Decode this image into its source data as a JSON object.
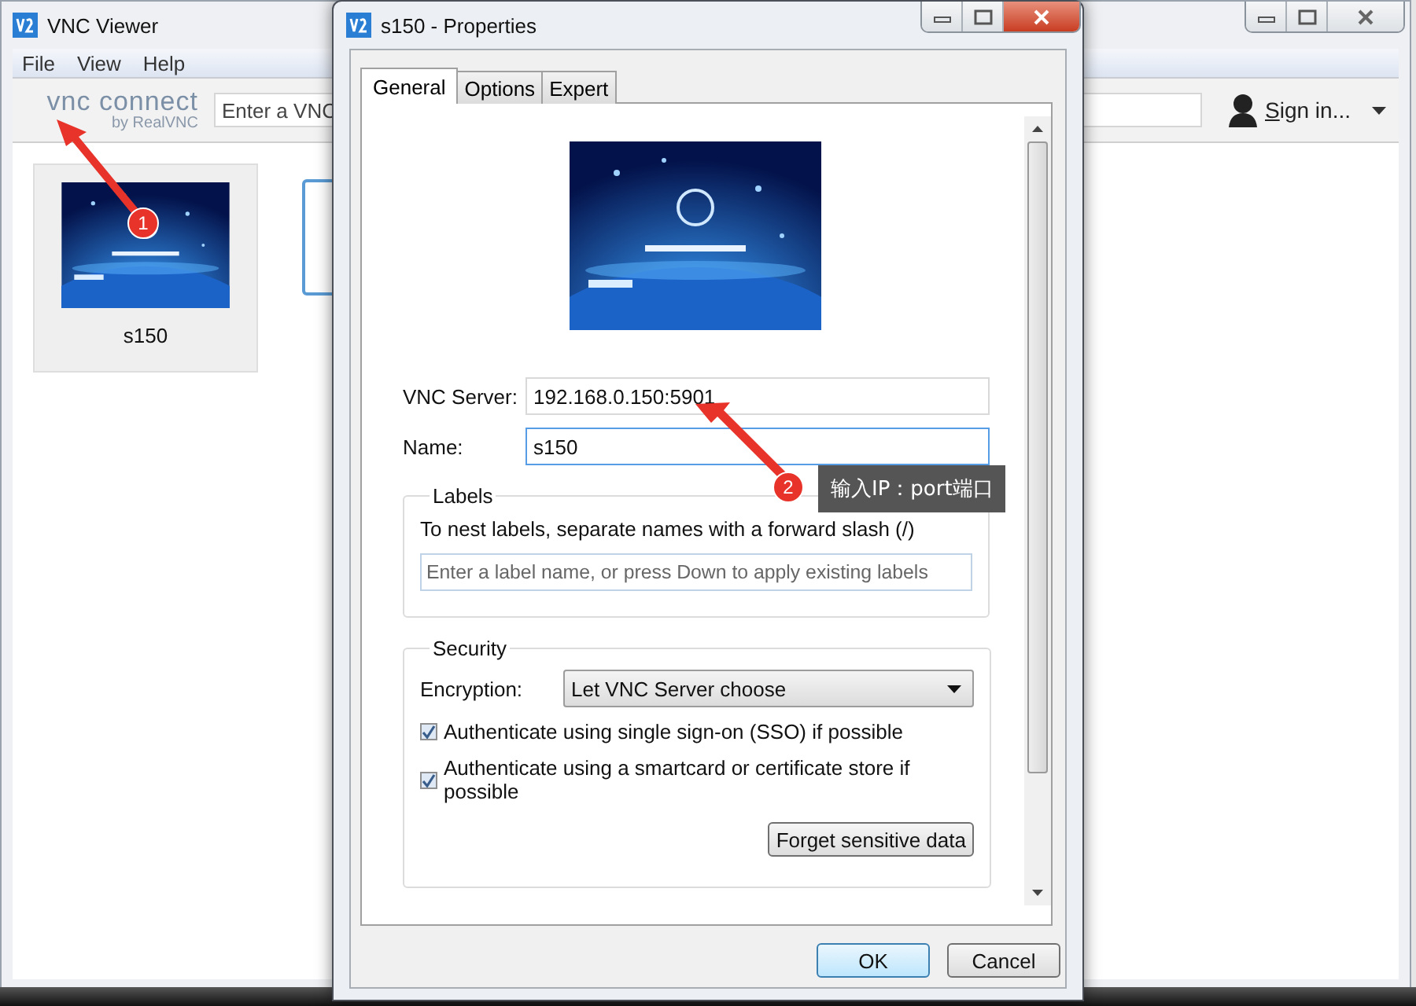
{
  "main_window": {
    "title": "VNC Viewer",
    "menu": [
      "File",
      "View",
      "Help"
    ],
    "logo": {
      "name": "vnc connect",
      "byline": "by RealVNC"
    },
    "address_field": {
      "placeholder": "Enter a VNC"
    },
    "sign_in": "Sign in...",
    "connections": [
      {
        "name": "s150",
        "selected": true,
        "kind": "picture"
      },
      {
        "selected": false
      }
    ]
  },
  "dialog": {
    "title": "s150 - Properties",
    "tabs": [
      {
        "label": "General",
        "selected": true
      },
      {
        "label": "Options",
        "selected": false
      },
      {
        "label": "Expert",
        "selected": false
      }
    ],
    "vnc_server": {
      "label": "VNC Server:",
      "value": "192.168.0.150:5901",
      "focused": false
    },
    "name": {
      "label": "Name:",
      "value": "s150",
      "focused": true
    },
    "labels": {
      "title": "Labels",
      "hint": "To nest labels, separate names with a forward slash (/)",
      "placeholder": "Enter a label name, or press Down to apply existing labels"
    },
    "security": {
      "title": "Security",
      "encryption": {
        "label": "Encryption:",
        "value": "Let VNC Server choose"
      },
      "options": [
        {
          "label": "Authenticate using single sign-on (SSO) if possible",
          "checked": true
        },
        {
          "label": "Authenticate using a smartcard or certificate store if possible",
          "checked": true
        }
      ],
      "forget_button": "Forget sensitive data"
    },
    "buttons": [
      {
        "label": "OK",
        "default": true
      },
      {
        "label": "Cancel",
        "default": false
      }
    ]
  },
  "annotations": [
    {
      "number": "1"
    },
    {
      "number": "2",
      "note": "输入IP：port端口"
    }
  ]
}
